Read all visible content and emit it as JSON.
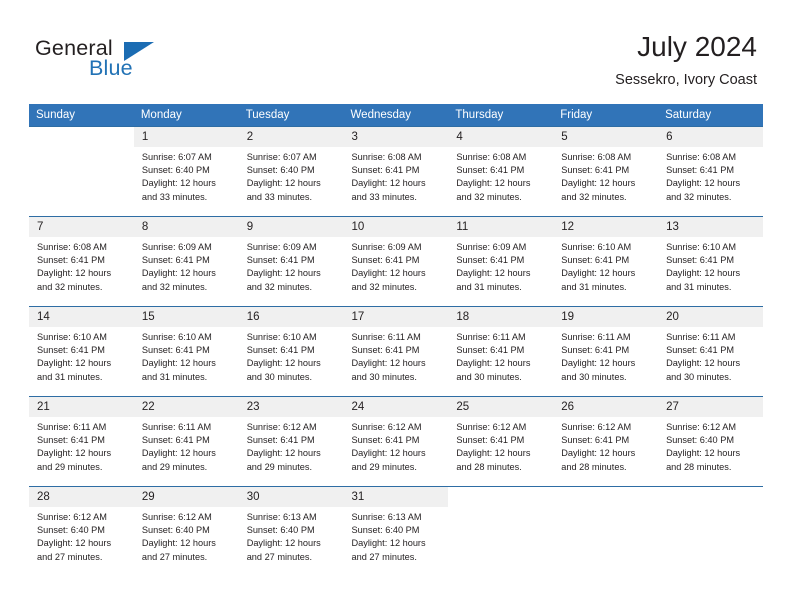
{
  "logo": {
    "word_top": "General",
    "word_bottom": "Blue",
    "triangle_color": "#1b6cb3",
    "blue_color": "#2272b5"
  },
  "header": {
    "title": "July 2024",
    "subtitle": "Sessekro, Ivory Coast"
  },
  "theme": {
    "header_bg": "#3174b8",
    "row_divider": "#2e6da4",
    "daynum_bg": "#f0f0f0",
    "text": "#231f20"
  },
  "calendar": {
    "weekday_headers": [
      "Sunday",
      "Monday",
      "Tuesday",
      "Wednesday",
      "Thursday",
      "Friday",
      "Saturday"
    ],
    "labels": {
      "sunrise": "Sunrise:",
      "sunset": "Sunset:",
      "daylight": "Daylight:"
    },
    "weeks": [
      [
        {
          "day": "",
          "blank": true,
          "sunrise": "",
          "sunset": "",
          "daylight_line1": "",
          "daylight_line2": ""
        },
        {
          "day": "1",
          "blank": false,
          "sunrise": "Sunrise: 6:07 AM",
          "sunset": "Sunset: 6:40 PM",
          "daylight_line1": "Daylight: 12 hours",
          "daylight_line2": "and 33 minutes."
        },
        {
          "day": "2",
          "blank": false,
          "sunrise": "Sunrise: 6:07 AM",
          "sunset": "Sunset: 6:40 PM",
          "daylight_line1": "Daylight: 12 hours",
          "daylight_line2": "and 33 minutes."
        },
        {
          "day": "3",
          "blank": false,
          "sunrise": "Sunrise: 6:08 AM",
          "sunset": "Sunset: 6:41 PM",
          "daylight_line1": "Daylight: 12 hours",
          "daylight_line2": "and 33 minutes."
        },
        {
          "day": "4",
          "blank": false,
          "sunrise": "Sunrise: 6:08 AM",
          "sunset": "Sunset: 6:41 PM",
          "daylight_line1": "Daylight: 12 hours",
          "daylight_line2": "and 32 minutes."
        },
        {
          "day": "5",
          "blank": false,
          "sunrise": "Sunrise: 6:08 AM",
          "sunset": "Sunset: 6:41 PM",
          "daylight_line1": "Daylight: 12 hours",
          "daylight_line2": "and 32 minutes."
        },
        {
          "day": "6",
          "blank": false,
          "sunrise": "Sunrise: 6:08 AM",
          "sunset": "Sunset: 6:41 PM",
          "daylight_line1": "Daylight: 12 hours",
          "daylight_line2": "and 32 minutes."
        }
      ],
      [
        {
          "day": "7",
          "blank": false,
          "sunrise": "Sunrise: 6:08 AM",
          "sunset": "Sunset: 6:41 PM",
          "daylight_line1": "Daylight: 12 hours",
          "daylight_line2": "and 32 minutes."
        },
        {
          "day": "8",
          "blank": false,
          "sunrise": "Sunrise: 6:09 AM",
          "sunset": "Sunset: 6:41 PM",
          "daylight_line1": "Daylight: 12 hours",
          "daylight_line2": "and 32 minutes."
        },
        {
          "day": "9",
          "blank": false,
          "sunrise": "Sunrise: 6:09 AM",
          "sunset": "Sunset: 6:41 PM",
          "daylight_line1": "Daylight: 12 hours",
          "daylight_line2": "and 32 minutes."
        },
        {
          "day": "10",
          "blank": false,
          "sunrise": "Sunrise: 6:09 AM",
          "sunset": "Sunset: 6:41 PM",
          "daylight_line1": "Daylight: 12 hours",
          "daylight_line2": "and 32 minutes."
        },
        {
          "day": "11",
          "blank": false,
          "sunrise": "Sunrise: 6:09 AM",
          "sunset": "Sunset: 6:41 PM",
          "daylight_line1": "Daylight: 12 hours",
          "daylight_line2": "and 31 minutes."
        },
        {
          "day": "12",
          "blank": false,
          "sunrise": "Sunrise: 6:10 AM",
          "sunset": "Sunset: 6:41 PM",
          "daylight_line1": "Daylight: 12 hours",
          "daylight_line2": "and 31 minutes."
        },
        {
          "day": "13",
          "blank": false,
          "sunrise": "Sunrise: 6:10 AM",
          "sunset": "Sunset: 6:41 PM",
          "daylight_line1": "Daylight: 12 hours",
          "daylight_line2": "and 31 minutes."
        }
      ],
      [
        {
          "day": "14",
          "blank": false,
          "sunrise": "Sunrise: 6:10 AM",
          "sunset": "Sunset: 6:41 PM",
          "daylight_line1": "Daylight: 12 hours",
          "daylight_line2": "and 31 minutes."
        },
        {
          "day": "15",
          "blank": false,
          "sunrise": "Sunrise: 6:10 AM",
          "sunset": "Sunset: 6:41 PM",
          "daylight_line1": "Daylight: 12 hours",
          "daylight_line2": "and 31 minutes."
        },
        {
          "day": "16",
          "blank": false,
          "sunrise": "Sunrise: 6:10 AM",
          "sunset": "Sunset: 6:41 PM",
          "daylight_line1": "Daylight: 12 hours",
          "daylight_line2": "and 30 minutes."
        },
        {
          "day": "17",
          "blank": false,
          "sunrise": "Sunrise: 6:11 AM",
          "sunset": "Sunset: 6:41 PM",
          "daylight_line1": "Daylight: 12 hours",
          "daylight_line2": "and 30 minutes."
        },
        {
          "day": "18",
          "blank": false,
          "sunrise": "Sunrise: 6:11 AM",
          "sunset": "Sunset: 6:41 PM",
          "daylight_line1": "Daylight: 12 hours",
          "daylight_line2": "and 30 minutes."
        },
        {
          "day": "19",
          "blank": false,
          "sunrise": "Sunrise: 6:11 AM",
          "sunset": "Sunset: 6:41 PM",
          "daylight_line1": "Daylight: 12 hours",
          "daylight_line2": "and 30 minutes."
        },
        {
          "day": "20",
          "blank": false,
          "sunrise": "Sunrise: 6:11 AM",
          "sunset": "Sunset: 6:41 PM",
          "daylight_line1": "Daylight: 12 hours",
          "daylight_line2": "and 30 minutes."
        }
      ],
      [
        {
          "day": "21",
          "blank": false,
          "sunrise": "Sunrise: 6:11 AM",
          "sunset": "Sunset: 6:41 PM",
          "daylight_line1": "Daylight: 12 hours",
          "daylight_line2": "and 29 minutes."
        },
        {
          "day": "22",
          "blank": false,
          "sunrise": "Sunrise: 6:11 AM",
          "sunset": "Sunset: 6:41 PM",
          "daylight_line1": "Daylight: 12 hours",
          "daylight_line2": "and 29 minutes."
        },
        {
          "day": "23",
          "blank": false,
          "sunrise": "Sunrise: 6:12 AM",
          "sunset": "Sunset: 6:41 PM",
          "daylight_line1": "Daylight: 12 hours",
          "daylight_line2": "and 29 minutes."
        },
        {
          "day": "24",
          "blank": false,
          "sunrise": "Sunrise: 6:12 AM",
          "sunset": "Sunset: 6:41 PM",
          "daylight_line1": "Daylight: 12 hours",
          "daylight_line2": "and 29 minutes."
        },
        {
          "day": "25",
          "blank": false,
          "sunrise": "Sunrise: 6:12 AM",
          "sunset": "Sunset: 6:41 PM",
          "daylight_line1": "Daylight: 12 hours",
          "daylight_line2": "and 28 minutes."
        },
        {
          "day": "26",
          "blank": false,
          "sunrise": "Sunrise: 6:12 AM",
          "sunset": "Sunset: 6:41 PM",
          "daylight_line1": "Daylight: 12 hours",
          "daylight_line2": "and 28 minutes."
        },
        {
          "day": "27",
          "blank": false,
          "sunrise": "Sunrise: 6:12 AM",
          "sunset": "Sunset: 6:40 PM",
          "daylight_line1": "Daylight: 12 hours",
          "daylight_line2": "and 28 minutes."
        }
      ],
      [
        {
          "day": "28",
          "blank": false,
          "sunrise": "Sunrise: 6:12 AM",
          "sunset": "Sunset: 6:40 PM",
          "daylight_line1": "Daylight: 12 hours",
          "daylight_line2": "and 27 minutes."
        },
        {
          "day": "29",
          "blank": false,
          "sunrise": "Sunrise: 6:12 AM",
          "sunset": "Sunset: 6:40 PM",
          "daylight_line1": "Daylight: 12 hours",
          "daylight_line2": "and 27 minutes."
        },
        {
          "day": "30",
          "blank": false,
          "sunrise": "Sunrise: 6:13 AM",
          "sunset": "Sunset: 6:40 PM",
          "daylight_line1": "Daylight: 12 hours",
          "daylight_line2": "and 27 minutes."
        },
        {
          "day": "31",
          "blank": false,
          "sunrise": "Sunrise: 6:13 AM",
          "sunset": "Sunset: 6:40 PM",
          "daylight_line1": "Daylight: 12 hours",
          "daylight_line2": "and 27 minutes."
        },
        {
          "day": "",
          "blank": true,
          "sunrise": "",
          "sunset": "",
          "daylight_line1": "",
          "daylight_line2": ""
        },
        {
          "day": "",
          "blank": true,
          "sunrise": "",
          "sunset": "",
          "daylight_line1": "",
          "daylight_line2": ""
        },
        {
          "day": "",
          "blank": true,
          "sunrise": "",
          "sunset": "",
          "daylight_line1": "",
          "daylight_line2": ""
        }
      ]
    ]
  }
}
